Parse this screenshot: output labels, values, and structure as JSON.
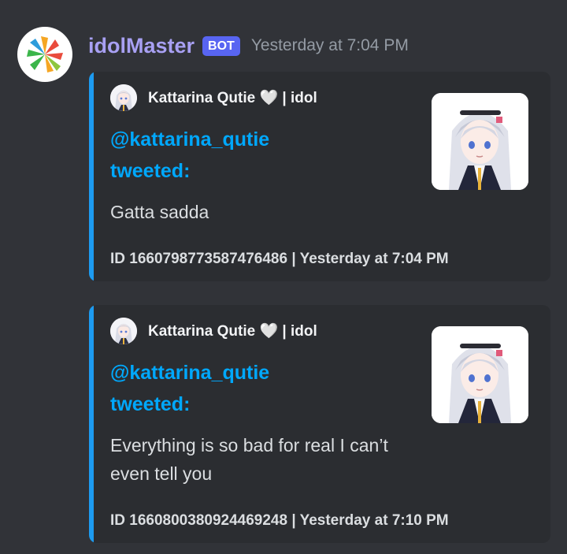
{
  "message": {
    "author": "idolMaster",
    "tag": "BOT",
    "timestamp": "Yesterday at 7:04 PM"
  },
  "embeds": [
    {
      "author_name": "Kattarina Qutie 🤍 | idol",
      "title": "@kattarina_qutie tweeted:",
      "description": "Gatta sadda",
      "footer": "ID 1660798773587476486 | Yesterday at 7:04 PM"
    },
    {
      "author_name": "Kattarina Qutie 🤍 | idol",
      "title": "@kattarina_qutie tweeted:",
      "description": "Everything is so bad for real I can’t even tell you",
      "footer": "ID 1660800380924469248 | Yesterday at 7:10 PM"
    }
  ],
  "colors": {
    "background": "#313338",
    "embed_background": "#2b2d31",
    "embed_accent": "#1d9bf0",
    "title_link": "#00a8fc",
    "author": "#a8a0f3",
    "bot_tag": "#5865f2"
  },
  "icons": {
    "bot_avatar": "idolmaster-logo-icon",
    "embed_author_avatar": "anime-girl-avatar-icon",
    "embed_thumbnail": "anime-girl-portrait-icon"
  }
}
